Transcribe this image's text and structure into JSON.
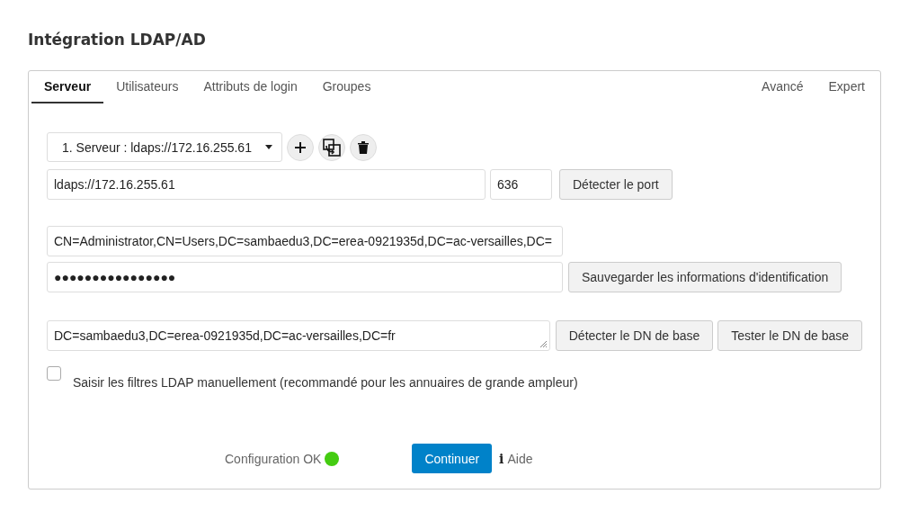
{
  "title": "Intégration LDAP/AD",
  "tabs": [
    {
      "label": "Serveur",
      "selected": true
    },
    {
      "label": "Utilisateurs",
      "selected": false
    },
    {
      "label": "Attributs de login",
      "selected": false
    },
    {
      "label": "Groupes",
      "selected": false
    }
  ],
  "tabs_right": [
    {
      "label": "Avancé",
      "selected": false
    },
    {
      "label": "Expert",
      "selected": false
    }
  ],
  "server_select": {
    "value": "1. Serveur : ldaps://172.16.255.61"
  },
  "host": {
    "value": "ldaps://172.16.255.61"
  },
  "port": {
    "value": "636"
  },
  "detect_port_button": "Détecter le port",
  "user_dn": {
    "value": "CN=Administrator,CN=Users,DC=sambaedu3,DC=erea-0921935d,DC=ac-versailles,DC="
  },
  "password": {
    "value": "●●●●●●●●●●●●●●●●"
  },
  "save_credentials_button": "Sauvegarder les informations d'identification",
  "base_dn": {
    "value": "DC=sambaedu3,DC=erea-0921935d,DC=ac-versailles,DC=fr"
  },
  "base_dn_buttons": [
    "Détecter le DN de base",
    "Tester le DN de base"
  ],
  "manual_filter": {
    "label": "Saisir les filtres LDAP manuellement (recommandé pour les annuaires de grande ampleur)",
    "checked": false
  },
  "status": {
    "label": "Configuration OK",
    "color": "#44cc11"
  },
  "continue_button": "Continuer",
  "help": {
    "icon": "i",
    "label": "Aide"
  }
}
